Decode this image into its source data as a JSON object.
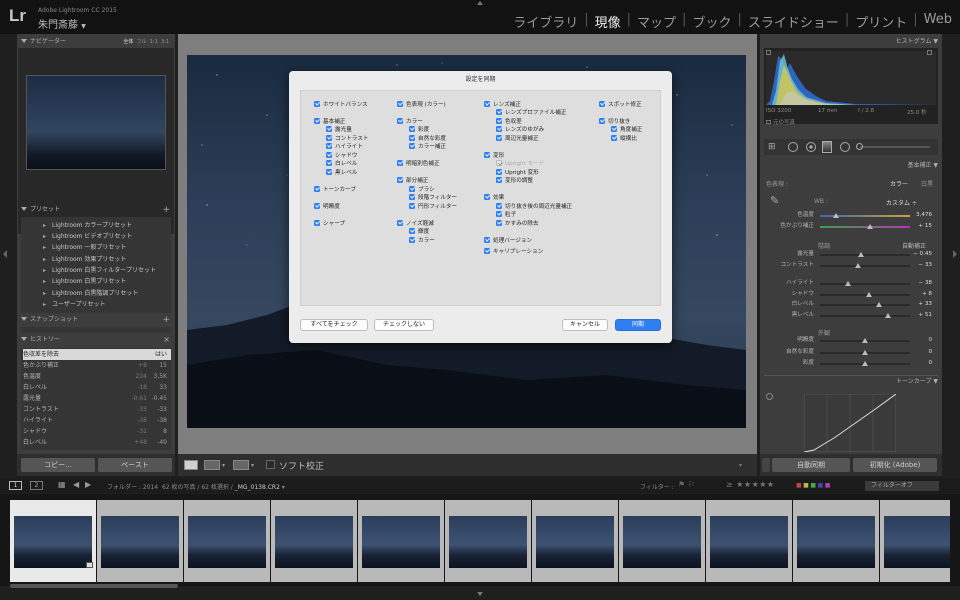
{
  "app": {
    "logo": "Lr",
    "name": "Adobe Lightroom CC 2015",
    "user": "朱門斎藤"
  },
  "modules": [
    {
      "label": "ライブラリ",
      "active": false
    },
    {
      "label": "現像",
      "active": true
    },
    {
      "label": "マップ",
      "active": false
    },
    {
      "label": "ブック",
      "active": false
    },
    {
      "label": "スライドショー",
      "active": false
    },
    {
      "label": "プリント",
      "active": false
    },
    {
      "label": "Web",
      "active": false
    }
  ],
  "navigator": {
    "title": "ナビゲーター",
    "zoom_options": [
      "全体",
      "フル",
      "1:1",
      "3:1"
    ]
  },
  "presets": {
    "title": "プリセット",
    "items": [
      "Lightroom カラープリセット",
      "Lightroom ビデオプリセット",
      "Lightroom 一般プリセット",
      "Lightroom 効果プリセット",
      "Lightroom 白黒フィルタープリセット",
      "Lightroom 白黒プリセット",
      "Lightroom 白黒階調プリセット",
      "ユーザープリセット"
    ]
  },
  "snapshot": {
    "title": "スナップショット"
  },
  "history": {
    "title": "ヒストリー",
    "rows": [
      {
        "label": "色収差を除去",
        "v1": "",
        "v2": "はい"
      },
      {
        "label": "色かぶり補正",
        "v1": "+8",
        "v2": "15"
      },
      {
        "label": "色温度",
        "v1": "224",
        "v2": "3,5K"
      },
      {
        "label": "白レベル",
        "v1": "-18",
        "v2": "33"
      },
      {
        "label": "露光量",
        "v1": "-0.61",
        "v2": "-0.45"
      },
      {
        "label": "コントラスト",
        "v1": "-33",
        "v2": "-33"
      },
      {
        "label": "ハイライト",
        "v1": "-38",
        "v2": "-38"
      },
      {
        "label": "シャドウ",
        "v1": "-31",
        "v2": "8"
      },
      {
        "label": "白レベル",
        "v1": "+48",
        "v2": "-49"
      }
    ]
  },
  "left_buttons": {
    "copy": "コピー...",
    "paste": "ペースト"
  },
  "dialog": {
    "title": "設定を同期",
    "items": [
      {
        "label": "ホワイトバランス",
        "checked": true
      },
      {
        "label": "基本補正",
        "checked": true
      },
      {
        "label": "露光量",
        "checked": true
      },
      {
        "label": "コントラスト",
        "checked": true
      },
      {
        "label": "ハイライト",
        "checked": true
      },
      {
        "label": "シャドウ",
        "checked": true
      },
      {
        "label": "白レベル",
        "checked": true
      },
      {
        "label": "黒レベル",
        "checked": true
      },
      {
        "label": "トーンカーブ",
        "checked": true
      },
      {
        "label": "明瞭度",
        "checked": true
      },
      {
        "label": "シャープ",
        "checked": true
      },
      {
        "label": "色表現 (カラー)",
        "checked": true
      },
      {
        "label": "カラー",
        "checked": true
      },
      {
        "label": "彩度",
        "checked": true
      },
      {
        "label": "自然な彩度",
        "checked": true
      },
      {
        "label": "カラー補正",
        "checked": true
      },
      {
        "label": "明暗別色補正",
        "checked": true
      },
      {
        "label": "部分補正",
        "checked": true
      },
      {
        "label": "ブラシ",
        "checked": true
      },
      {
        "label": "段階フィルター",
        "checked": true
      },
      {
        "label": "円形フィルター",
        "checked": true
      },
      {
        "label": "ノイズ軽減",
        "checked": true
      },
      {
        "label": "輝度",
        "checked": true
      },
      {
        "label": "カラー",
        "checked": true
      },
      {
        "label": "レンズ補正",
        "checked": true
      },
      {
        "label": "レンズプロファイル補正",
        "checked": true
      },
      {
        "label": "色収差",
        "checked": true
      },
      {
        "label": "レンズのゆがみ",
        "checked": true
      },
      {
        "label": "周辺光量補正",
        "checked": true
      },
      {
        "label": "変形",
        "checked": true
      },
      {
        "label": "Upright モード",
        "checked": true,
        "disabled": true
      },
      {
        "label": "Upright 変形",
        "checked": true
      },
      {
        "label": "変形の調整",
        "checked": true
      },
      {
        "label": "効果",
        "checked": true
      },
      {
        "label": "切り抜き後の周辺光量補正",
        "checked": true
      },
      {
        "label": "粒子",
        "checked": true
      },
      {
        "label": "かすみの除去",
        "checked": true
      },
      {
        "label": "処理バージョン",
        "checked": true
      },
      {
        "label": "キャリブレーション",
        "checked": true
      },
      {
        "label": "スポット修正",
        "checked": true
      },
      {
        "label": "切り抜き",
        "checked": true
      },
      {
        "label": "角度補正",
        "checked": true
      },
      {
        "label": "縦横比",
        "checked": true
      }
    ],
    "buttons": {
      "check_all": "すべてをチェック",
      "check_none": "チェックしない",
      "cancel": "キャンセル",
      "sync": "同期"
    }
  },
  "toolbar": {
    "soft_proof": "ソフト校正"
  },
  "histogram": {
    "title": "ヒストグラム",
    "iso": "ISO 3200",
    "focal": "17 mm",
    "aperture": "f / 2.8",
    "shutter": "25.0 秒",
    "original": "元の写真"
  },
  "basic": {
    "title": "基本補正",
    "treatment_label": "色表現 :",
    "treatment_color": "カラー",
    "treatment_bw": "白黒",
    "wb_label": "WB :",
    "wb_value": "カスタム ÷",
    "tone_label": "階調",
    "auto_label": "自動補正",
    "presence_label": "外観",
    "sliders": [
      {
        "label": "色温度",
        "value": "3,476",
        "pos": 0.18
      },
      {
        "label": "色かぶり補正",
        "value": "+ 15",
        "pos": 0.56
      },
      {
        "label": "露光量",
        "value": "− 0.45",
        "pos": 0.46
      },
      {
        "label": "コントラスト",
        "value": "− 33",
        "pos": 0.42
      },
      {
        "label": "ハイライト",
        "value": "− 38",
        "pos": 0.31
      },
      {
        "label": "シャドウ",
        "value": "+ 8",
        "pos": 0.54
      },
      {
        "label": "白レベル",
        "value": "+ 33",
        "pos": 0.66
      },
      {
        "label": "黒レベル",
        "value": "+ 51",
        "pos": 0.75
      },
      {
        "label": "明瞭度",
        "value": "0",
        "pos": 0.5
      },
      {
        "label": "自然な彩度",
        "value": "0",
        "pos": 0.5
      },
      {
        "label": "彩度",
        "value": "0",
        "pos": 0.5
      }
    ]
  },
  "tone_curve": {
    "title": "トーンカーブ"
  },
  "right_buttons": {
    "auto_sync": "自動同期",
    "reset": "初期化 (Adobe)"
  },
  "filmstrip_bar": {
    "page1": "1",
    "page2": "2",
    "folder": "フォルダー : 2014",
    "count": "62 枚の写真 / 62 枚選択 /",
    "file": "_MG_0138.CR2",
    "filter_label": "フィルター :",
    "filter_state": "フィルターオフ"
  }
}
